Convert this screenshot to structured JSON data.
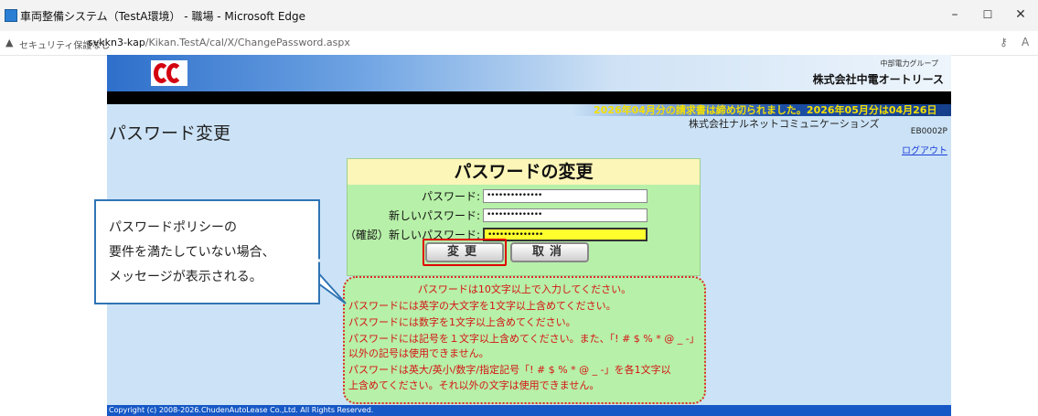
{
  "browser": {
    "window_title": "車両整備システム（TestA環境） - 職場 - Microsoft Edge",
    "security_label": "セキュリティ保護なし",
    "url_host": "svkkn3-kap",
    "url_path": "/Kikan.TestA/cal/X/ChangePassword.aspx"
  },
  "header": {
    "group_name": "中部電力グループ",
    "company_name": "株式会社中電オートリース",
    "notice": "2026年04月分の請求書は締め切られました。2026年05月分は04月26日"
  },
  "page": {
    "title": "パスワード変更",
    "vendor": "株式会社ナルネットコミュニケーションズ",
    "screen_id": "EB0002P",
    "logout_label": "ログアウト"
  },
  "form": {
    "heading": "パスワードの変更",
    "fields": [
      {
        "label": "パスワード:",
        "value": "••••••••••••••"
      },
      {
        "label": "新しいパスワード:",
        "value": "••••••••••••••"
      },
      {
        "label": "（確認）新しいパスワード:",
        "value": "••••••••••••••"
      }
    ],
    "change_button": "変更",
    "cancel_button": "取消"
  },
  "messages": [
    "パスワードは10文字以上で入力してください。",
    "パスワードには英字の大文字を1文字以上含めてください。",
    "パスワードには数字を1文字以上含めてください。",
    "パスワードには記号を１文字以上含めてください。また、「! # $ % * @ _ -」",
    "以外の記号は使用できません。",
    "パスワードは英大/英小/数字/指定記号「! # $ % * @ _ -」を各1文字以",
    "上含めてください。それ以外の文字は使用できません。"
  ],
  "footer": {
    "copyright": "Copyright (c) 2008-2026.ChudenAutoLease Co.,Ltd. All Rights Reserved."
  },
  "callout": {
    "lines": [
      "パスワードポリシーの",
      "要件を満たしていない場合、",
      "メッセージが表示される。"
    ]
  }
}
